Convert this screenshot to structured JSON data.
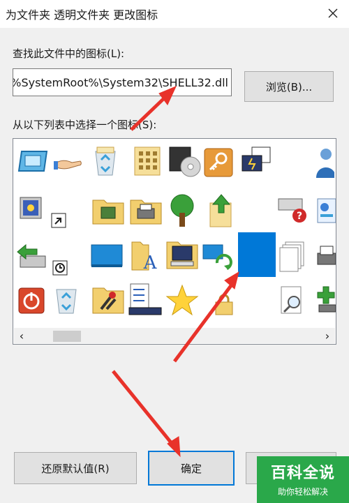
{
  "window": {
    "title": "为文件夹 透明文件夹 更改图标"
  },
  "labels": {
    "find_icons": "查找此文件中的图标(L):",
    "select_icon": "从以下列表中选择一个图标(S):"
  },
  "path_field": {
    "value": "%SystemRoot%\\System32\\SHELL32.dll"
  },
  "buttons": {
    "browse": "浏览(B)...",
    "restore_default": "还原默认值(R)",
    "ok": "确定",
    "cancel": ""
  },
  "icons": [
    "display-icon",
    "hand-share-icon",
    "recycle-bin-full-icon",
    "keypad-icon",
    "disc-player-icon",
    "key-icon",
    "network-setup-icon",
    "user-icon",
    "screensaver-icon",
    "shortcut-arrow-icon",
    "network-folder-icon",
    "printer-folder-icon",
    "tree-icon",
    "upload-file-icon",
    "drive-error-icon",
    "control-panel-icon",
    "drive-arrow-icon",
    "clock-icon",
    "desktop-icon",
    "font-folder-icon",
    "computer-folder-icon",
    "sync-icon",
    "transparent-blank-icon",
    "file-stack-icon",
    "printer-icon",
    "power-icon",
    "recycle-bin-empty-icon",
    "tools-folder-icon",
    "task-list-icon",
    "star-icon",
    "lock-icon",
    "magnifier-icon",
    "network-plus-icon"
  ],
  "selected_icon": "transparent-blank-icon",
  "scrollbar": {
    "left_arrow": "‹",
    "right_arrow": "›"
  },
  "watermark": {
    "title": "百科全说",
    "subtitle": "助你轻松解决"
  },
  "colors": {
    "selection": "#0078d7",
    "annotation_arrow": "#e8322a",
    "watermark": "#2aa84a"
  }
}
